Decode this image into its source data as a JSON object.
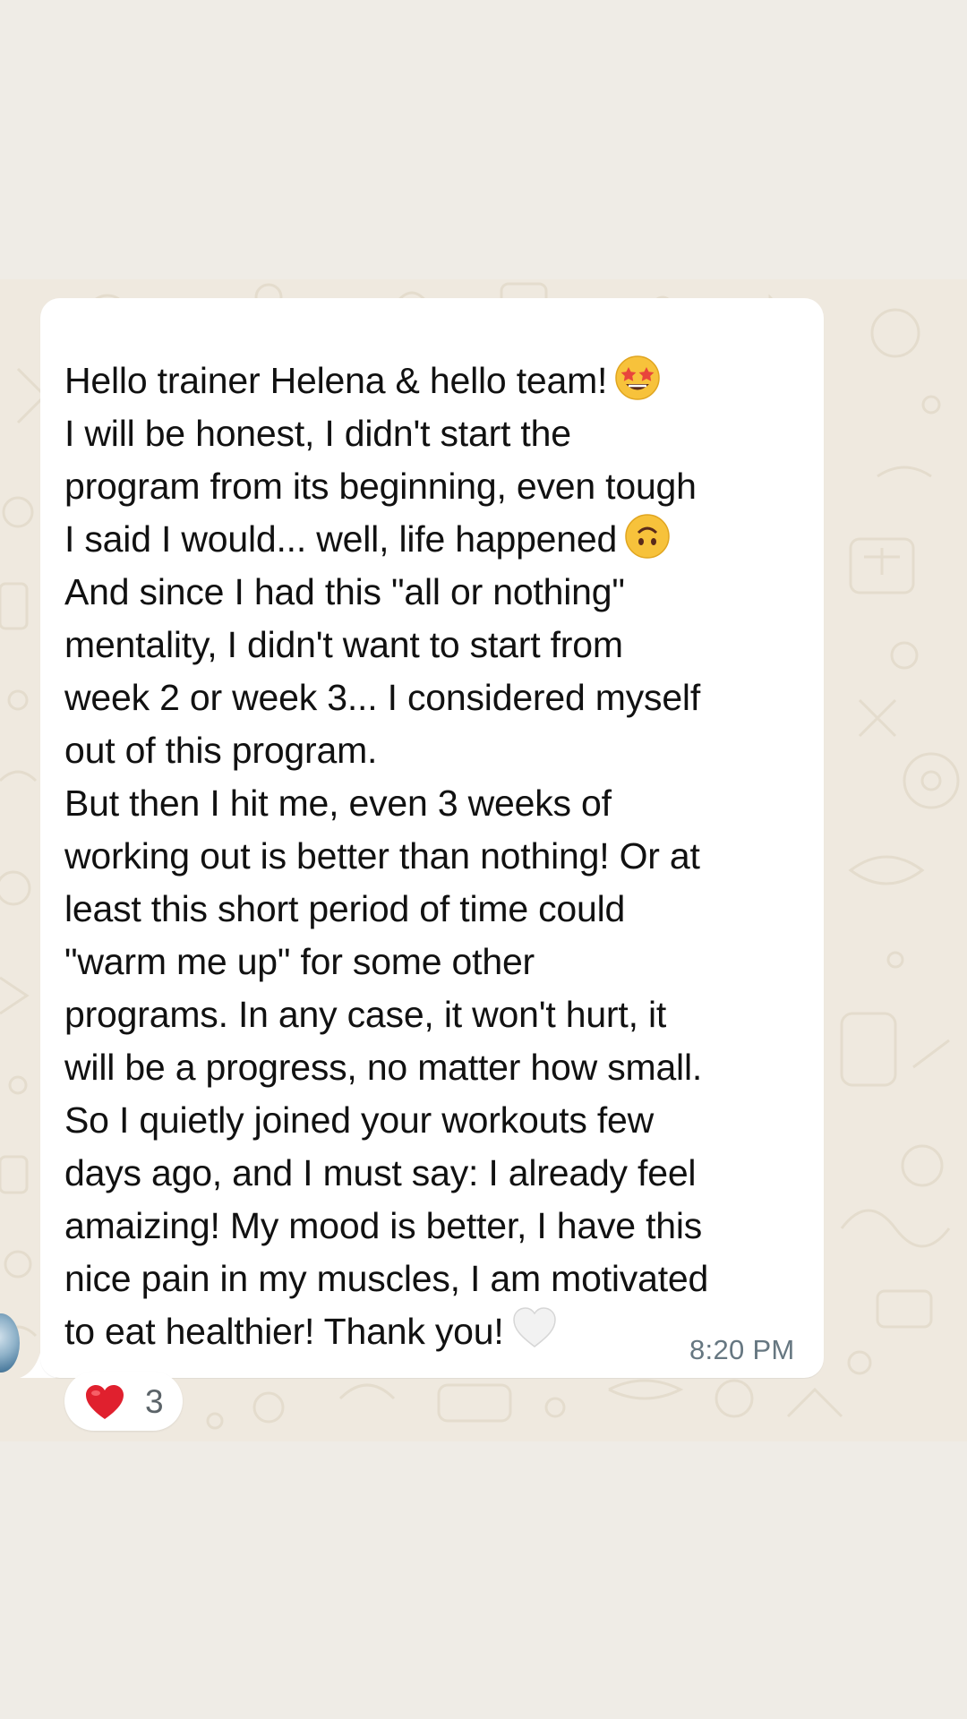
{
  "message": {
    "lines": [
      "Hello trainer Helena & hello team!",
      "I will be honest, I didn't start the",
      "program from its beginning, even tough",
      "I said I would... well, life happened",
      "And since I had this \"all or nothing\"",
      "mentality, I didn't want to start from",
      "week 2 or week 3... I considered myself",
      "out of this program.",
      "But then I hit me, even 3 weeks of",
      "working out is better than nothing! Or at",
      "least this short period of time could",
      "\"warm me up\" for some other",
      "programs. In any case, it won't hurt, it",
      "will be a progress, no matter how small.",
      "So I quietly joined your workouts few",
      "days ago, and I must say: I already feel",
      "amaizing! My mood is better, I have this",
      "nice pain in my muscles, I am motivated",
      "to eat healthier! Thank you!"
    ],
    "emojis": {
      "line1": "star-struck-emoji-icon",
      "line4": "upside-down-face-emoji-icon",
      "line19": "white-heart-emoji-icon"
    },
    "time": "8:20 PM"
  },
  "reaction": {
    "icon": "red-heart-icon",
    "count": "3"
  },
  "colors": {
    "bubble": "#ffffff",
    "wallpaper": "#efe9df",
    "page": "#efece6",
    "timestamp": "#667781",
    "heart": "#e0202e"
  }
}
